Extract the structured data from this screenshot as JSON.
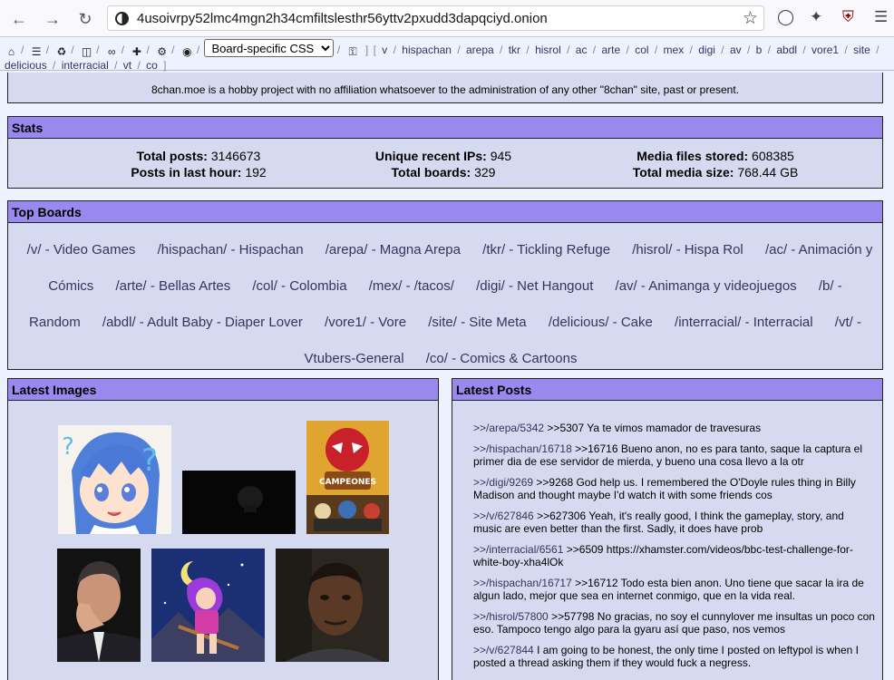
{
  "browser": {
    "url": "4usoivrpy52lmc4mgn2h34cmfiltslesthr56yttv2pxudd3dapqciyd.onion"
  },
  "site_nav": {
    "css_select": "Board-specific CSS",
    "open_bracket": "[",
    "close_bracket": "]",
    "boards": [
      "v",
      "hispachan",
      "arepa",
      "tkr",
      "hisrol",
      "ac",
      "arte",
      "col",
      "mex",
      "digi",
      "av",
      "b",
      "abdl",
      "vore1",
      "site",
      "delicious",
      "interracial",
      "vt",
      "co"
    ]
  },
  "notice": "8chan.moe is a hobby project with no affiliation whatsoever to the administration of any other \"8chan\" site, past or present.",
  "stats": {
    "title": "Stats",
    "total_posts_label": "Total posts:",
    "total_posts": "3146673",
    "posts_last_hour_label": "Posts in last hour:",
    "posts_last_hour": "192",
    "unique_ips_label": "Unique recent IPs:",
    "unique_ips": "945",
    "total_boards_label": "Total boards:",
    "total_boards": "329",
    "media_files_label": "Media files stored:",
    "media_files": "608385",
    "media_size_label": "Total media size:",
    "media_size": "768.44 GB"
  },
  "top_boards": {
    "title": "Top Boards",
    "items": [
      "/v/ - Video Games",
      "/hispachan/ - Hispachan",
      "/arepa/ - Magna Arepa",
      "/tkr/ - Tickling Refuge",
      "/hisrol/ - Hispa Rol",
      "/ac/ - Animación y Cómics",
      "/arte/ - Bellas Artes",
      "/col/ - Colombia",
      "/mex/ - /tacos/",
      "/digi/ - Net Hangout",
      "/av/ - Animanga y videojuegos",
      "/b/ - Random",
      "/abdl/ - Adult Baby - Diaper Lover",
      "/vore1/ - Vore",
      "/site/ - Site Meta",
      "/delicious/ - Cake",
      "/interracial/ - Interracial",
      "/vt/ - Vtubers-General",
      "/co/ - Comics & Cartoons"
    ]
  },
  "latest_images": {
    "title": "Latest Images"
  },
  "latest_posts": {
    "title": "Latest Posts",
    "items": [
      {
        "link": ">>/arepa/5342",
        "text": ">>5307 Ya te vimos mamador de travesuras"
      },
      {
        "link": ">>/hispachan/16718",
        "text": ">>16716 Bueno anon, no es para tanto, saque la captura el primer dia de ese servidor de mierda, y bueno una cosa llevo a la otr"
      },
      {
        "link": ">>/digi/9269",
        "text": ">>9268 God help us. I remembered the O'Doyle rules thing in Billy Madison and thought maybe I'd watch it with some friends cos"
      },
      {
        "link": ">>/v/627846",
        "text": ">>627306 Yeah, it's really good, I think the gameplay, story, and music are even better than the first. Sadly, it does have prob"
      },
      {
        "link": ">>/interracial/6561",
        "text": ">>6509 https://xhamster.com/videos/bbc-test-challenge-for-white-boy-xha4lOk"
      },
      {
        "link": ">>/hispachan/16717",
        "text": ">>16712 Todo esta bien anon. Uno tiene que sacar la ira de algun lado, mejor que sea en internet conmigo, que en la vida real."
      },
      {
        "link": ">>/hisrol/57800",
        "text": ">>57798 No gracias, no soy el cunnylover me insultas un poco con eso. Tampoco tengo algo para la gyaru así que paso, nos vemos"
      },
      {
        "link": ">>/v/627844",
        "text": "I am going to be honest, the only time I posted on leftypol is when I posted a thread asking them if they would fuck a negress."
      }
    ]
  },
  "colors": {
    "title_bar": "#9988ee",
    "box_bg": "#d6daf0",
    "page_bg": "#eef2ff",
    "link": "#34345c"
  }
}
